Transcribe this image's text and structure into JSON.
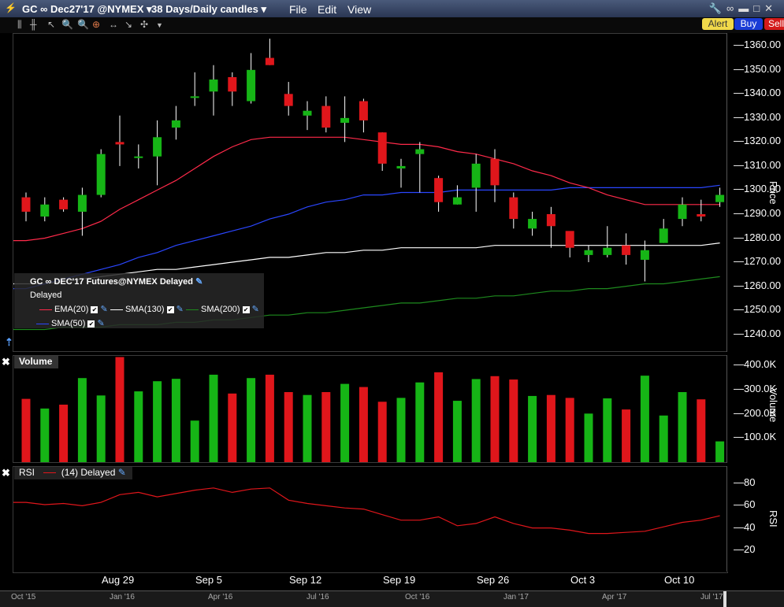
{
  "titlebar": {
    "symbol": "GC ∞ Dec27'17 @NYMEX ▾",
    "period": "38 Days/Daily candles ▾",
    "menu": [
      "File",
      "Edit",
      "View"
    ]
  },
  "buttons": {
    "alert": "Alert",
    "buy": "Buy",
    "sell": "Sell"
  },
  "legend": {
    "title": "GC ∞ DEC'17 Futures@NYMEX Delayed",
    "delayed": "Delayed",
    "items": [
      {
        "label": "EMA(20)",
        "color": "#ff2a4a"
      },
      {
        "label": "SMA(130)",
        "color": "#ffffff"
      },
      {
        "label": "SMA(200)",
        "color": "#1e8a1e"
      },
      {
        "label": "SMA(50)",
        "color": "#2a46ff"
      }
    ]
  },
  "price_axis": {
    "label": "Price",
    "ticks": [
      "1360.00",
      "1350.00",
      "1340.00",
      "1330.00",
      "1320.00",
      "1310.00",
      "1300.00",
      "1290.00",
      "1280.00",
      "1270.00",
      "1260.00",
      "1250.00",
      "1240.00"
    ]
  },
  "volume_panel": {
    "title": "Volume",
    "axis_label": "Volume",
    "ticks": [
      "400.0K",
      "300.0K",
      "200.0K",
      "100.0K"
    ]
  },
  "rsi_panel": {
    "title": "RSI",
    "legend": "(14) Delayed",
    "axis_label": "RSI",
    "ticks": [
      "80",
      "60",
      "40",
      "20"
    ]
  },
  "x_axis": {
    "labels": [
      "Aug 29",
      "Sep 5",
      "Sep 12",
      "Sep 19",
      "Sep 26",
      "Oct 3",
      "Oct 10"
    ]
  },
  "scrollbar": {
    "labels": [
      "Oct '15",
      "Jan '16",
      "Apr '16",
      "Jul '16",
      "Oct '16",
      "Jan '17",
      "Apr '17",
      "Jul '17"
    ]
  },
  "colors": {
    "up": "#16b516",
    "down": "#e0161b",
    "ema": "#ff2a4a",
    "sma50": "#2a46ff",
    "sma130": "#ffffff",
    "sma200": "#1e8a1e"
  },
  "chart_data": {
    "type": "candlestick",
    "price_range": [
      1233,
      1365
    ],
    "candles": [
      {
        "o": 1297,
        "h": 1299,
        "l": 1287,
        "c": 1291
      },
      {
        "o": 1289,
        "h": 1297,
        "l": 1287,
        "c": 1294
      },
      {
        "o": 1296,
        "h": 1297,
        "l": 1291,
        "c": 1292
      },
      {
        "o": 1291,
        "h": 1301,
        "l": 1281,
        "c": 1298
      },
      {
        "o": 1298,
        "h": 1317,
        "l": 1297,
        "c": 1315
      },
      {
        "o": 1320,
        "h": 1331,
        "l": 1310,
        "c": 1319
      },
      {
        "o": 1314,
        "h": 1319,
        "l": 1309,
        "c": 1314
      },
      {
        "o": 1314,
        "h": 1329,
        "l": 1302,
        "c": 1322
      },
      {
        "o": 1326,
        "h": 1335,
        "l": 1321,
        "c": 1329
      },
      {
        "o": 1339,
        "h": 1349,
        "l": 1335,
        "c": 1339
      },
      {
        "o": 1341,
        "h": 1352,
        "l": 1331,
        "c": 1346
      },
      {
        "o": 1347,
        "h": 1349,
        "l": 1335,
        "c": 1341
      },
      {
        "o": 1337,
        "h": 1357,
        "l": 1336,
        "c": 1350
      },
      {
        "o": 1355,
        "h": 1363,
        "l": 1352,
        "c": 1352
      },
      {
        "o": 1340,
        "h": 1345,
        "l": 1331,
        "c": 1335
      },
      {
        "o": 1331,
        "h": 1337,
        "l": 1325,
        "c": 1333
      },
      {
        "o": 1335,
        "h": 1339,
        "l": 1324,
        "c": 1326
      },
      {
        "o": 1328,
        "h": 1339,
        "l": 1320,
        "c": 1330
      },
      {
        "o": 1337,
        "h": 1338,
        "l": 1324,
        "c": 1329
      },
      {
        "o": 1324,
        "h": 1324,
        "l": 1308,
        "c": 1311
      },
      {
        "o": 1309,
        "h": 1313,
        "l": 1301,
        "c": 1310
      },
      {
        "o": 1315,
        "h": 1320,
        "l": 1299,
        "c": 1317
      },
      {
        "o": 1305,
        "h": 1306,
        "l": 1291,
        "c": 1295
      },
      {
        "o": 1294,
        "h": 1302,
        "l": 1294,
        "c": 1297
      },
      {
        "o": 1301,
        "h": 1315,
        "l": 1291,
        "c": 1311
      },
      {
        "o": 1313,
        "h": 1317,
        "l": 1295,
        "c": 1302
      },
      {
        "o": 1297,
        "h": 1299,
        "l": 1284,
        "c": 1288
      },
      {
        "o": 1284,
        "h": 1291,
        "l": 1281,
        "c": 1288
      },
      {
        "o": 1290,
        "h": 1293,
        "l": 1276,
        "c": 1285
      },
      {
        "o": 1283,
        "h": 1282,
        "l": 1272,
        "c": 1276
      },
      {
        "o": 1273,
        "h": 1277,
        "l": 1270,
        "c": 1275
      },
      {
        "o": 1273,
        "h": 1285,
        "l": 1272,
        "c": 1276
      },
      {
        "o": 1277,
        "h": 1282,
        "l": 1269,
        "c": 1273
      },
      {
        "o": 1271,
        "h": 1279,
        "l": 1262,
        "c": 1275
      },
      {
        "o": 1278,
        "h": 1288,
        "l": 1278,
        "c": 1284
      },
      {
        "o": 1288,
        "h": 1297,
        "l": 1285,
        "c": 1294
      },
      {
        "o": 1290,
        "h": 1296,
        "l": 1287,
        "c": 1289
      },
      {
        "o": 1295,
        "h": 1301,
        "l": 1293,
        "c": 1298
      }
    ],
    "ema20": [
      1279,
      1280,
      1282,
      1284,
      1287,
      1292,
      1296,
      1300,
      1304,
      1309,
      1314,
      1318,
      1321,
      1322,
      1322,
      1322,
      1322,
      1322,
      1321,
      1320,
      1319,
      1319,
      1318,
      1316,
      1315,
      1313,
      1311,
      1308,
      1306,
      1303,
      1301,
      1298,
      1296,
      1294,
      1294,
      1294,
      1294,
      1294
    ],
    "sma50": [
      1259,
      1261,
      1263,
      1265,
      1267,
      1269,
      1272,
      1274,
      1277,
      1279,
      1281,
      1283,
      1285,
      1288,
      1290,
      1293,
      1295,
      1296,
      1298,
      1298,
      1299,
      1299,
      1299,
      1300,
      1300,
      1300,
      1300,
      1300,
      1300,
      1301,
      1301,
      1301,
      1301,
      1301,
      1301,
      1301,
      1301,
      1302
    ],
    "sma130": [
      1261,
      1261,
      1262,
      1263,
      1264,
      1265,
      1266,
      1267,
      1267,
      1268,
      1269,
      1270,
      1271,
      1272,
      1272,
      1273,
      1274,
      1274,
      1275,
      1275,
      1276,
      1276,
      1276,
      1276,
      1276,
      1277,
      1277,
      1277,
      1277,
      1277,
      1277,
      1277,
      1277,
      1277,
      1277,
      1277,
      1277,
      1278
    ],
    "sma200": [
      1242,
      1242,
      1243,
      1243,
      1243,
      1244,
      1244,
      1244,
      1245,
      1245,
      1246,
      1246,
      1247,
      1248,
      1248,
      1249,
      1249,
      1250,
      1251,
      1252,
      1253,
      1253,
      1254,
      1255,
      1255,
      1256,
      1256,
      1257,
      1258,
      1258,
      1259,
      1259,
      1260,
      1261,
      1261,
      1262,
      1263,
      1264
    ],
    "volume": [
      262,
      222,
      238,
      348,
      276,
      435,
      293,
      335,
      345,
      172,
      362,
      284,
      348,
      362,
      290,
      278,
      290,
      324,
      311,
      250,
      266,
      330,
      372,
      254,
      344,
      356,
      342,
      274,
      278,
      266,
      201,
      264,
      218,
      358,
      193,
      290,
      260,
      86
    ],
    "volume_range": [
      0,
      440
    ],
    "rsi": [
      63,
      61,
      62,
      60,
      63,
      70,
      72,
      68,
      71,
      74,
      76,
      72,
      75,
      76,
      65,
      62,
      60,
      58,
      57,
      52,
      47,
      47,
      50,
      42,
      44,
      50,
      44,
      40,
      40,
      38,
      35,
      35,
      36,
      37,
      41,
      45,
      47,
      51
    ],
    "rsi_range": [
      0,
      95
    ]
  }
}
